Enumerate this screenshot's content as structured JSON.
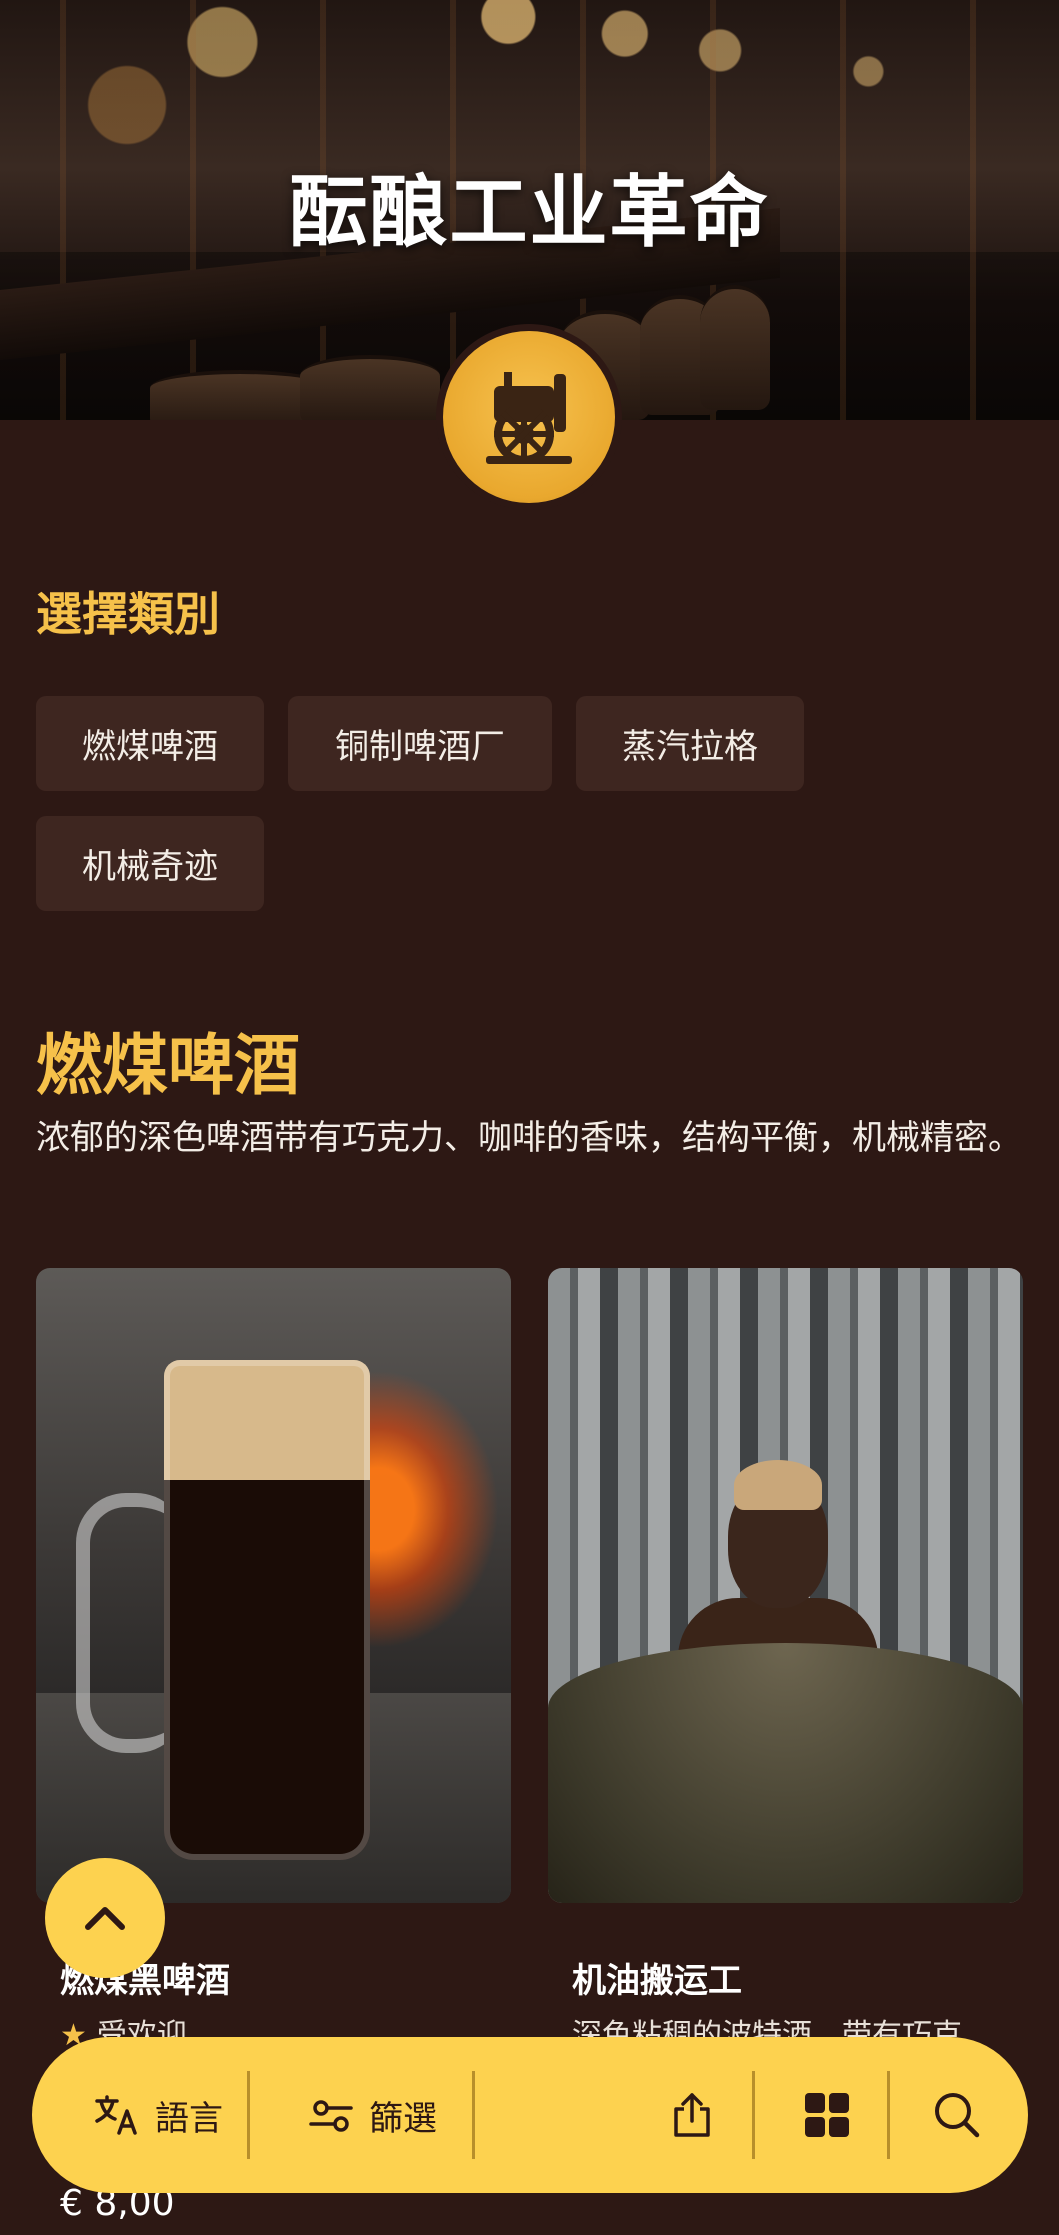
{
  "hero": {
    "title": "酝酿工业革命",
    "logo_icon": "steam-engine-logo-icon"
  },
  "categories_section": {
    "label": "選擇類別",
    "chips": [
      {
        "label": "燃煤啤酒"
      },
      {
        "label": "铜制啤酒厂"
      },
      {
        "label": "蒸汽拉格"
      },
      {
        "label": "机械奇迹"
      }
    ]
  },
  "category": {
    "title": "燃煤啤酒",
    "description": "浓郁的深色啤酒带有巧克力、咖啡的香味，结构平衡，机械精密。"
  },
  "products": [
    {
      "title": "燃煤黑啤酒",
      "badge": "受欢迎",
      "price": "€ 8,00"
    },
    {
      "title": "机油搬运工",
      "description": "深色粘稠的波特酒，带有巧克"
    }
  ],
  "toolbar": {
    "language_label": "語言",
    "filter_label": "篩選"
  },
  "colors": {
    "background": "#2d1814",
    "accent": "#f6c14a",
    "toolbar": "#fdd24f",
    "chip": "#3e2620"
  }
}
